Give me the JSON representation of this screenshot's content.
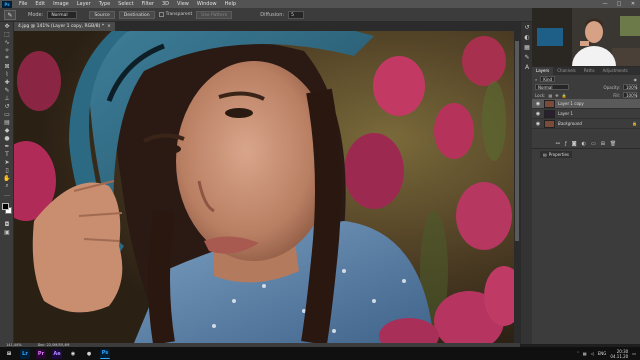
{
  "app": {
    "logo": "Ps",
    "window_controls": [
      "—",
      "□",
      "✕"
    ]
  },
  "menu": [
    "File",
    "Edit",
    "Image",
    "Layer",
    "Type",
    "Select",
    "Filter",
    "3D",
    "View",
    "Window",
    "Help"
  ],
  "options": {
    "tool_icon": "brush-tool-icon",
    "mode_label": "Mode:",
    "mode_value": "Normal",
    "source_button": "Source",
    "destination_button": "Destination",
    "transparent_label": "Transparent",
    "use_pattern_button": "Use Pattern",
    "diffusion_label": "Diffusion:",
    "diffusion_value": "5"
  },
  "document": {
    "tab_title": "4.jpg @ 141% (Layer 1 copy, RGB/8) *",
    "close_glyph": "×"
  },
  "status": {
    "zoom": "141,44%",
    "doc_info": "Doc: 22,0M/55,4M"
  },
  "layers_panel": {
    "tabs": [
      "Layers",
      "Channels",
      "Paths",
      "Adjustments"
    ],
    "active_tab": "Layers",
    "kind_label": "Kind",
    "blend_mode": "Normal",
    "opacity_label": "Opacity:",
    "opacity_value": "100%",
    "lock_label": "Lock:",
    "fill_label": "Fill:",
    "fill_value": "100%",
    "layers": [
      {
        "name": "Layer 1 copy",
        "active": true,
        "thumb": "skin"
      },
      {
        "name": "Layer 1",
        "active": false,
        "thumb": "dark"
      },
      {
        "name": "Background",
        "active": false,
        "thumb": "skin"
      }
    ],
    "footer_icons": [
      "link-icon",
      "fx-icon",
      "mask-icon",
      "adjustment-icon",
      "group-icon",
      "new-layer-icon",
      "trash-icon"
    ]
  },
  "properties_panel": {
    "tab_label": "Properties"
  },
  "taskbar": {
    "apps": [
      {
        "name": "windows-start-icon",
        "glyph": "⊞",
        "bg": "#101010",
        "fg": "#ffffff"
      },
      {
        "name": "lightroom-icon",
        "glyph": "Lr",
        "bg": "#001e36",
        "fg": "#31a8ff"
      },
      {
        "name": "premiere-icon",
        "glyph": "Pr",
        "bg": "#2a0634",
        "fg": "#e77cff"
      },
      {
        "name": "after-effects-icon",
        "glyph": "Ae",
        "bg": "#1f0a40",
        "fg": "#b08cff"
      },
      {
        "name": "chrome-icon",
        "glyph": "◉",
        "bg": "#101010",
        "fg": "#e8e8e8"
      },
      {
        "name": "obs-icon",
        "glyph": "●",
        "bg": "#101010",
        "fg": "#cfcfcf"
      },
      {
        "name": "photoshop-taskbar-icon",
        "glyph": "Ps",
        "bg": "#001e36",
        "fg": "#31a8ff"
      }
    ],
    "language": "ENG",
    "time": "20:30",
    "date": "04.11.20"
  },
  "colors": {
    "accent": "#31a8ff",
    "panel": "#3c3c3c",
    "menubar": "#535353",
    "taskbar": "#101010"
  }
}
